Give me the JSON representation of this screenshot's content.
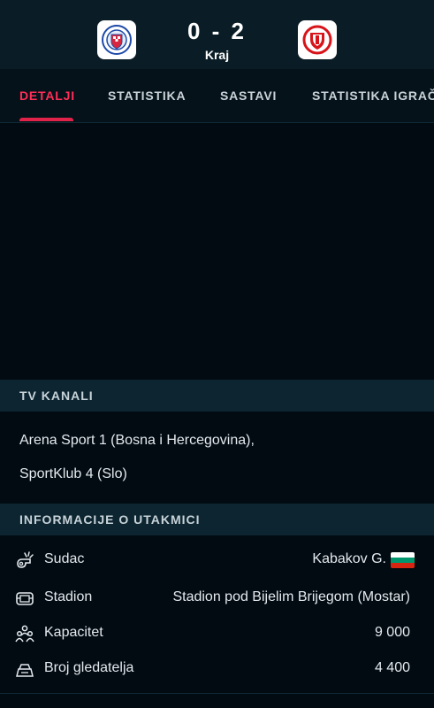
{
  "match": {
    "score": "0 - 2",
    "status": "Kraj",
    "home_logo": "shield-crest-icon",
    "away_logo": "club-crest-icon"
  },
  "tabs": [
    {
      "label": "DETALJI",
      "active": true
    },
    {
      "label": "STATISTIKA",
      "active": false
    },
    {
      "label": "SASTAVI",
      "active": false
    },
    {
      "label": "STATISTIKA IGRAČ",
      "active": false
    }
  ],
  "tv": {
    "header": "TV KANALI",
    "line1": "Arena Sport 1 (Bosna i Hercegovina),",
    "line2": "SportKlub 4 (Slo)"
  },
  "info": {
    "header": "INFORMACIJE O UTAKMICI",
    "rows": [
      {
        "label": "Sudac",
        "value": "Kabakov G.",
        "icon": "whistle-icon"
      },
      {
        "label": "Stadion",
        "value": "Stadion pod Bijelim Brijegom (Mostar)",
        "icon": "stadium-icon"
      },
      {
        "label": "Kapacitet",
        "value": "9 000",
        "icon": "people-icon"
      },
      {
        "label": "Broj gledatelja",
        "value": "4 400",
        "icon": "attendance-icon"
      }
    ]
  },
  "colors": {
    "accent": "#e1234a",
    "background": "#020b12",
    "header_bg": "#0a1d26",
    "section_bg": "#0c2530"
  }
}
